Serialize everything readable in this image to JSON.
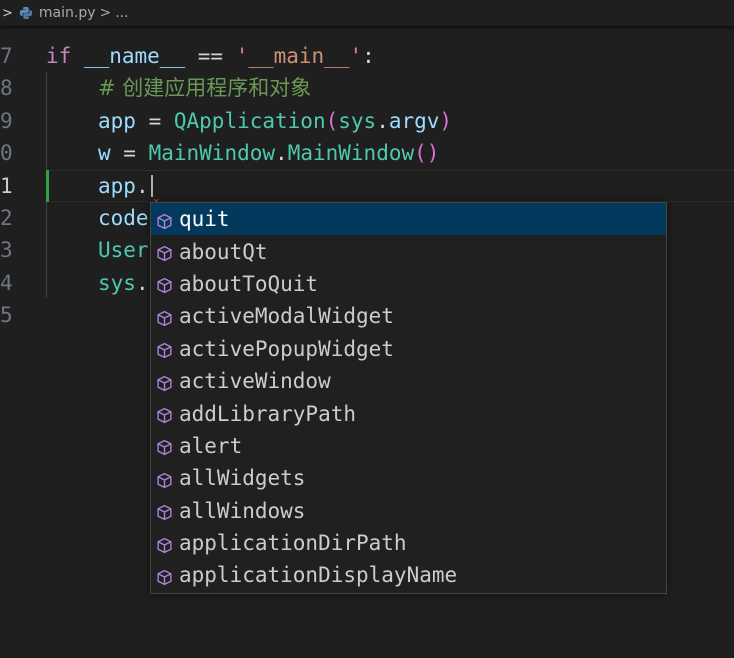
{
  "breadcrumb": {
    "file": "main.py",
    "separator": ">",
    "rest": "..."
  },
  "editor": {
    "partial_line_number": "6",
    "current_line": "11",
    "lines": [
      {
        "num": "7"
      },
      {
        "num": "8"
      },
      {
        "num": "9"
      },
      {
        "num": "0"
      },
      {
        "num": "1"
      },
      {
        "num": "2"
      },
      {
        "num": "3"
      },
      {
        "num": "4"
      },
      {
        "num": "5"
      }
    ],
    "tokens": {
      "l7": {
        "kw": "if",
        "name": "__name__",
        "op": " == ",
        "str": "'__main__'",
        "colon": ":"
      },
      "l8": {
        "comment": "# 创建应用程序和对象"
      },
      "l9": {
        "var": "app",
        "eq": " = ",
        "cls": "QApplication",
        "lp": "(",
        "sys": "sys",
        "dot": ".",
        "argv": "argv",
        "rp": ")"
      },
      "l10": {
        "var": "w",
        "eq": " = ",
        "cls1": "MainWindow",
        "dot": ".",
        "cls2": "MainWindow",
        "parens": "()"
      },
      "l11": {
        "var": "app",
        "dot": "."
      },
      "l12": {
        "text": "code"
      },
      "l13": {
        "text": "User"
      },
      "l14": {
        "text": "sys",
        "dot": "."
      }
    }
  },
  "suggestions": {
    "icon": "cube-method-icon",
    "accent": "#b180d7",
    "selected_bg": "#04395e",
    "items": [
      "quit",
      "aboutQt",
      "aboutToQuit",
      "activeModalWidget",
      "activePopupWidget",
      "activeWindow",
      "addLibraryPath",
      "alert",
      "allWidgets",
      "allWindows",
      "applicationDirPath",
      "applicationDisplayName"
    ]
  }
}
